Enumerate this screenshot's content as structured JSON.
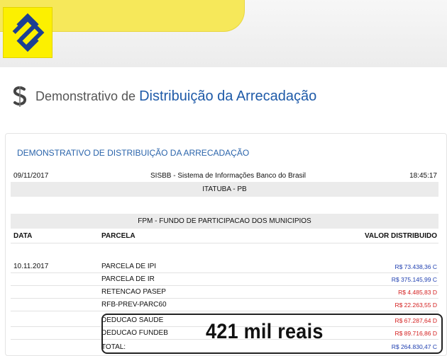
{
  "page": {
    "title_light": "Demonstrativo de",
    "title_strong": "Distribuição da Arrecadação"
  },
  "panel": {
    "heading": "DEMONSTRATIVO DE DISTRIBUIÇÃO DA ARRECADAÇÃO",
    "date": "09/11/2017",
    "system": "SISBB - Sistema de Informações Banco do Brasil",
    "time": "18:45:17",
    "municipality": "ITATUBA - PB",
    "fund": "FPM - FUNDO DE PARTICIPACAO DOS MUNICIPIOS",
    "columns": {
      "data": "DATA",
      "parcela": "PARCELA",
      "valor": "VALOR DISTRIBUIDO"
    },
    "rows": [
      {
        "data": "10.11.2017",
        "parcela": "PARCELA DE IPI",
        "valor": "R$ 73.438,36 C"
      },
      {
        "data": "",
        "parcela": "PARCELA DE IR",
        "valor": "R$ 375.145,99 C"
      },
      {
        "data": "",
        "parcela": "RETENCAO PASEP",
        "valor": "R$ 4.485,83 D"
      },
      {
        "data": "",
        "parcela": "RFB-PREV-PARC60",
        "valor": "R$ 22.263,55 D"
      },
      {
        "data": "",
        "parcela": "DEDUCAO SAUDE",
        "valor": "R$ 67.287,64 D"
      },
      {
        "data": "",
        "parcela": "DEDUCAO FUNDEB",
        "valor": "R$ 89.716,86 D"
      },
      {
        "data": "",
        "parcela": "TOTAL:",
        "valor": "R$ 264.830,47 C"
      }
    ]
  },
  "annotation": {
    "caption": "421 mil reais"
  },
  "colors": {
    "credit": "#1f3fb0",
    "debit": "#d42020",
    "heading_blue": "#2a64ab",
    "brand_yellow": "#fcf000"
  },
  "icons": {
    "logo": "banco-do-brasil-logo",
    "title_icon": "dollar-s-icon"
  }
}
